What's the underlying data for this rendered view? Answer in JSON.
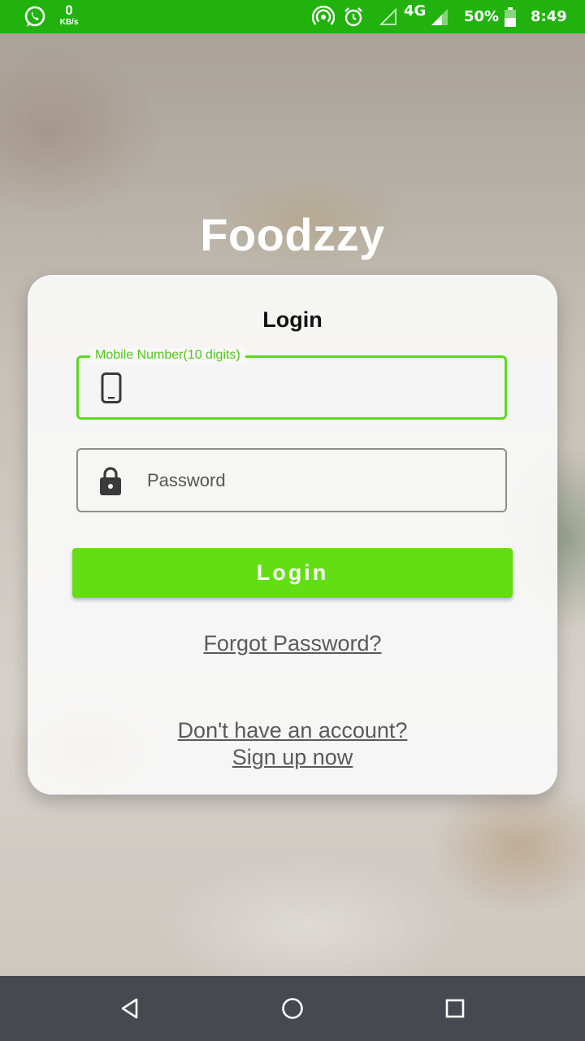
{
  "status_bar": {
    "network_speed": "0",
    "network_speed_unit": "KB/s",
    "network_type": "4G",
    "battery": "50%",
    "time": "8:49",
    "background_color": "#21b20e",
    "icons": [
      "whatsapp-icon",
      "hotspot-icon",
      "alarm-icon",
      "signal-empty-icon",
      "signal-icon",
      "battery-icon"
    ]
  },
  "app": {
    "brand": "Foodzzy"
  },
  "login_card": {
    "title": "Login",
    "mobile_field": {
      "label": "Mobile Number(10 digits)",
      "value": "",
      "icon": "phone-icon"
    },
    "password_field": {
      "placeholder": "Password",
      "value": "",
      "icon": "lock-icon"
    },
    "login_button": "Login",
    "forgot_password": "Forgot Password?",
    "no_account": "Don't have an account?",
    "sign_up": "Sign up now"
  },
  "colors": {
    "accent": "#63de14",
    "focus_border": "#5fd81e",
    "nav_bar": "#464a50"
  },
  "nav_bar": {
    "icons": [
      "back-icon",
      "home-icon",
      "recents-icon"
    ]
  }
}
